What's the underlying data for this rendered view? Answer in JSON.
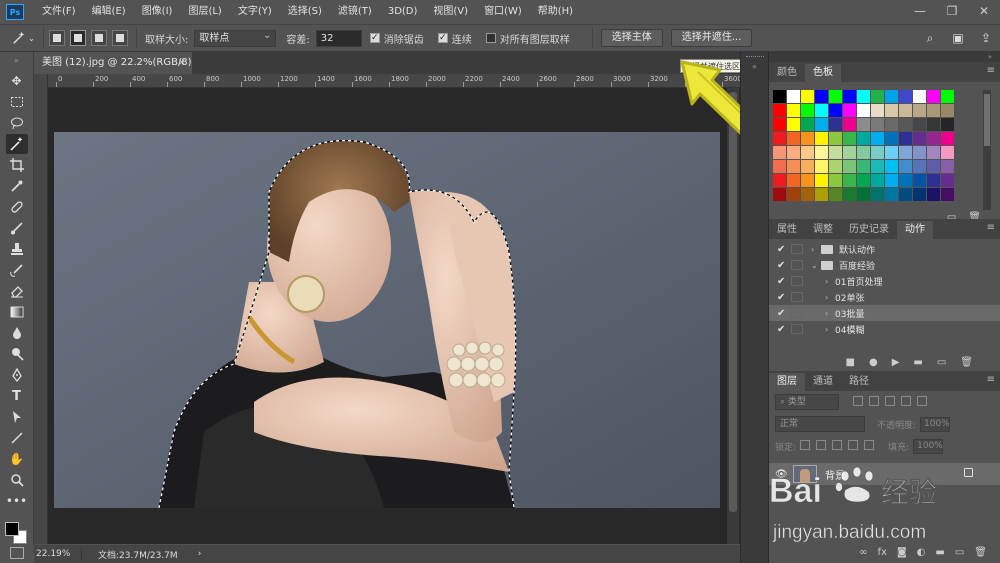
{
  "app": {
    "logo": "Ps"
  },
  "menu": [
    "文件(F)",
    "编辑(E)",
    "图像(I)",
    "图层(L)",
    "文字(Y)",
    "选择(S)",
    "滤镜(T)",
    "3D(D)",
    "视图(V)",
    "窗口(W)",
    "帮助(H)"
  ],
  "options": {
    "sample_size_label": "取样大小:",
    "sample_size_value": "取样点",
    "tolerance_label": "容差:",
    "tolerance_value": "32",
    "antialias_label": "消除锯齿",
    "contiguous_label": "连续",
    "sample_all_layers_label": "对所有图层取样",
    "select_subject_label": "选择主体",
    "select_and_mask_label": "选择并遮住..."
  },
  "tooltip": "选择并遮住选区",
  "document": {
    "tab_title": "美图 (12).jpg @ 22.2%(RGB/8)",
    "ruler_labels": [
      "0",
      "200",
      "400",
      "600",
      "800",
      "1000",
      "1200",
      "1400",
      "1600",
      "1800",
      "2000",
      "2200",
      "2400",
      "2600",
      "2800",
      "3000",
      "3200",
      "3400",
      "3600",
      "3800"
    ]
  },
  "status": {
    "zoom": "22.19%",
    "doc_info": "文档:23.7M/23.7M",
    "arrow": "›"
  },
  "swatches_panel": {
    "tabs": [
      "颜色",
      "色板"
    ],
    "rows": [
      [
        "#000000",
        "#ffffff",
        "#ffff00",
        "#0000ff",
        "#00ff00",
        "#0000ff",
        "#00ffff",
        "#22b14c",
        "#00a2e8",
        "#3f48cc",
        "#ffffff",
        "#ff00ff",
        "#00ff00"
      ],
      [
        "#ff0000",
        "#ffff00",
        "#00ff00",
        "#00ffff",
        "#0000ff",
        "#ff00ff",
        "#ffffff",
        "#e8dcc8",
        "#d9c9a8",
        "#c8b898",
        "#b8a888",
        "#a89878",
        "#988868"
      ],
      [
        "#ff0000",
        "#ffff00",
        "#00a651",
        "#00aeef",
        "#2e3192",
        "#ec008c",
        "#8c8c8c",
        "#7a7a7a",
        "#696969",
        "#585858",
        "#474747",
        "#363636",
        "#252525"
      ],
      [
        "#ed1c24",
        "#f26522",
        "#f7941d",
        "#fff200",
        "#8dc63f",
        "#39b54a",
        "#00a99d",
        "#00aeef",
        "#0072bc",
        "#2e3192",
        "#662d91",
        "#92278f",
        "#ec008c"
      ],
      [
        "#f69679",
        "#f9ad81",
        "#fdc68a",
        "#fff79a",
        "#c4df9b",
        "#a3d39c",
        "#82ca9c",
        "#7accc8",
        "#6dcff6",
        "#7ea7d8",
        "#8493ca",
        "#a187be",
        "#f49ac1"
      ],
      [
        "#f26c4f",
        "#f68e56",
        "#fbaf5d",
        "#fff467",
        "#acd372",
        "#7cc576",
        "#3bb878",
        "#1abbb4",
        "#00bff3",
        "#438ccb",
        "#5574b9",
        "#605ca8",
        "#855fa8"
      ],
      [
        "#ed1c24",
        "#f26522",
        "#f7941d",
        "#fff200",
        "#8dc63f",
        "#39b54a",
        "#00a651",
        "#00a99d",
        "#00aeef",
        "#0072bc",
        "#0054a6",
        "#2e3192",
        "#662d91"
      ],
      [
        "#9e0b0f",
        "#a0410d",
        "#a36209",
        "#aba000",
        "#598527",
        "#1a7b30",
        "#007236",
        "#00746b",
        "#0076a3",
        "#004b80",
        "#003471",
        "#1b1464",
        "#440e62"
      ]
    ]
  },
  "actions_panel": {
    "tabs": [
      "属性",
      "调整",
      "历史记录",
      "动作"
    ],
    "items": [
      {
        "label": "默认动作",
        "level": 0,
        "type": "set"
      },
      {
        "label": "百度经验",
        "level": 0,
        "type": "set-open"
      },
      {
        "label": "01首页处理",
        "level": 1,
        "type": "action"
      },
      {
        "label": "02单张",
        "level": 1,
        "type": "action"
      },
      {
        "label": "03批量",
        "level": 1,
        "type": "action"
      },
      {
        "label": "04模糊",
        "level": 1,
        "type": "action"
      }
    ]
  },
  "layers_panel": {
    "tabs": [
      "图层",
      "通道",
      "路径"
    ],
    "kind_label": "类型",
    "blend_mode": "正常",
    "opacity_label": "不透明度:",
    "opacity_value": "100%",
    "lock_label": "锁定:",
    "fill_label": "填充:",
    "fill_value": "100%",
    "layer_name": "背景"
  },
  "watermark": {
    "text": "Bai 经验",
    "url": "jingyan.baidu.com"
  }
}
